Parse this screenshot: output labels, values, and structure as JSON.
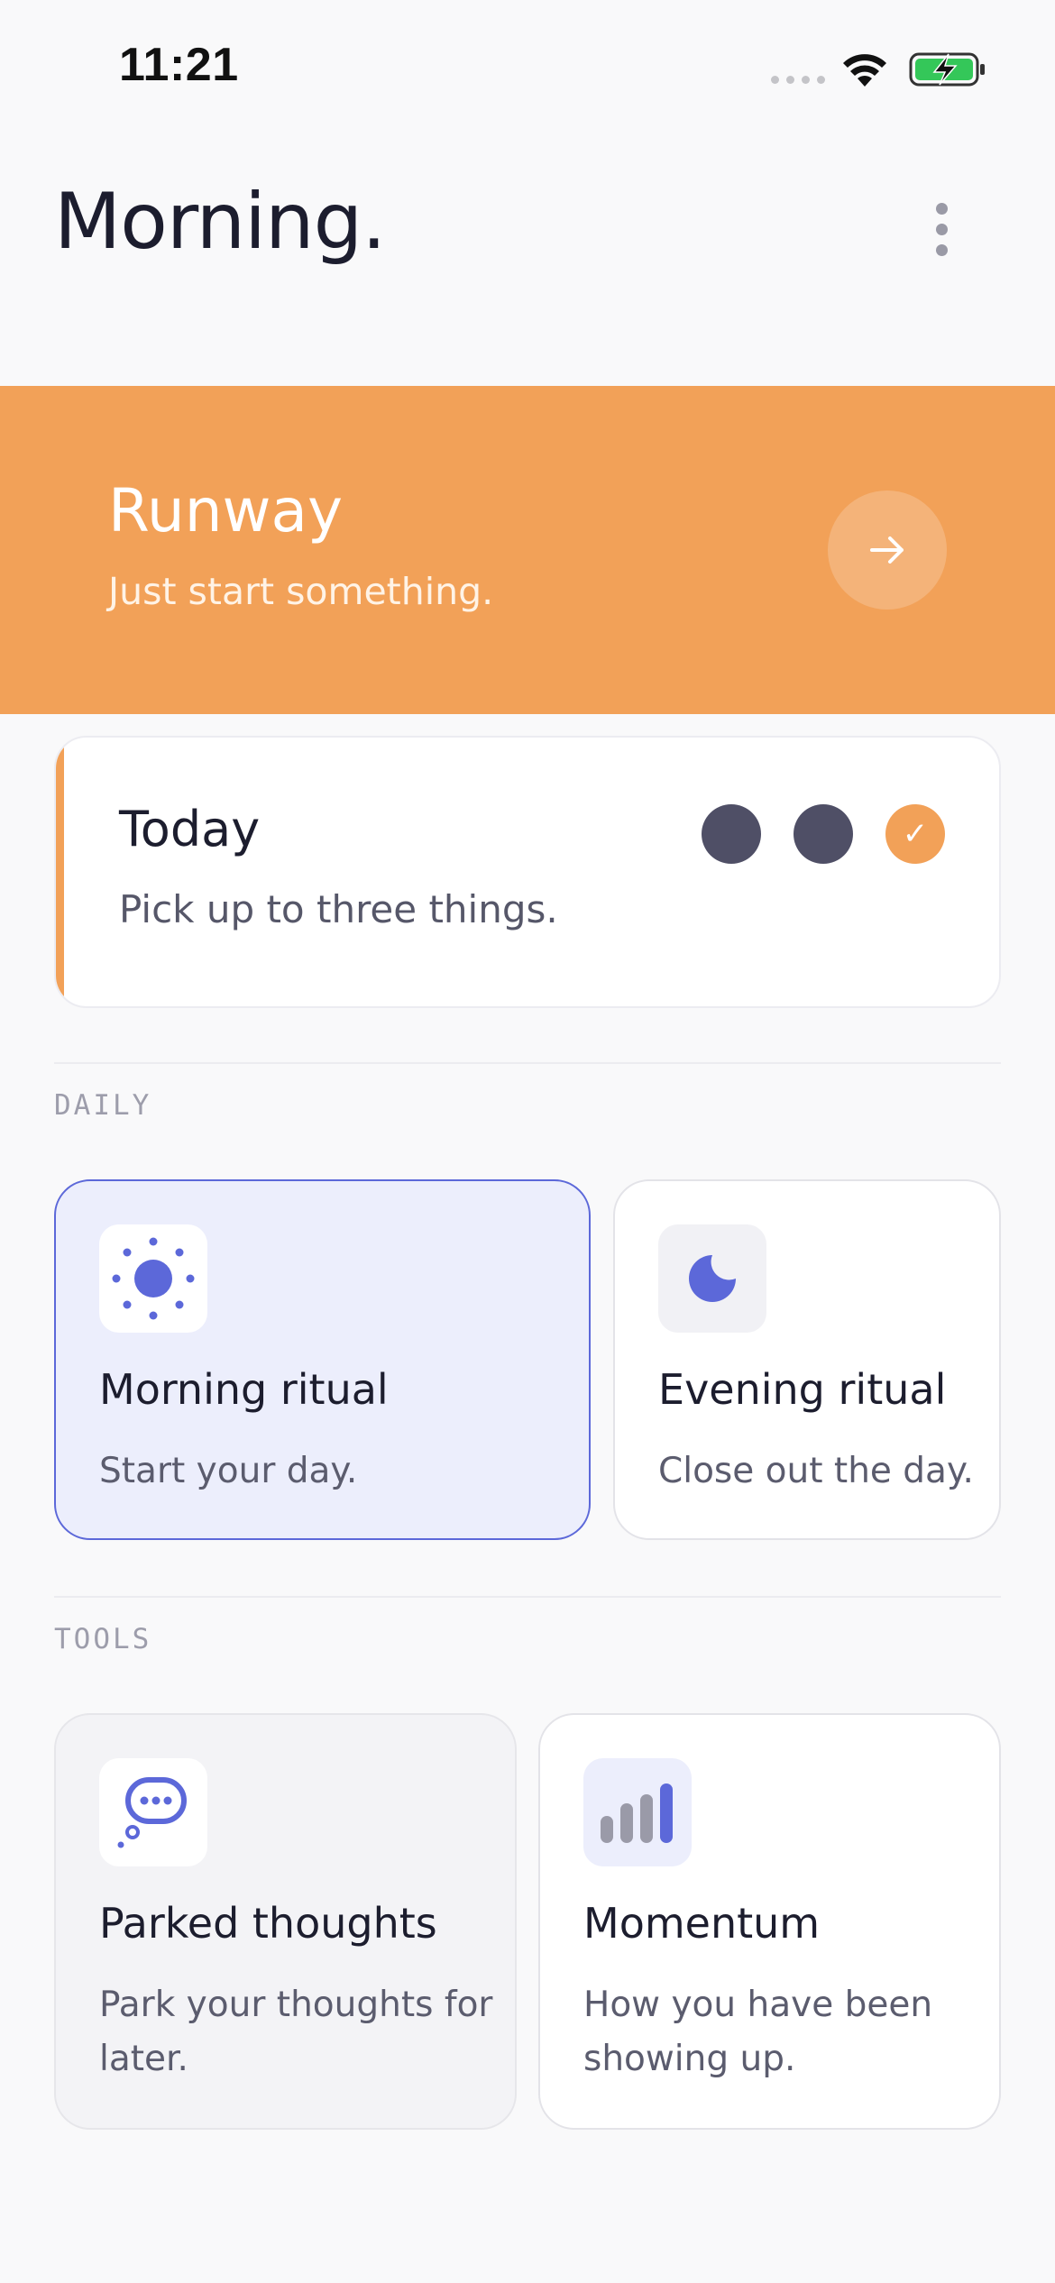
{
  "status_bar": {
    "time": "11:21"
  },
  "header": {
    "title": "Morning."
  },
  "runway": {
    "title": "Runway",
    "subtitle": "Just start something."
  },
  "today": {
    "title": "Today",
    "subtitle": "Pick up to three things.",
    "slots": [
      {
        "state": "empty"
      },
      {
        "state": "empty"
      },
      {
        "state": "done",
        "mark": "✓"
      }
    ]
  },
  "daily": {
    "label": "DAILY",
    "cards": [
      {
        "title": "Morning ritual",
        "description": "Start your day.",
        "icon": "sun-icon",
        "selected": true
      },
      {
        "title": "Evening ritual",
        "description": "Close out the day.",
        "icon": "moon-icon",
        "selected": false
      }
    ]
  },
  "tools": {
    "label": "TOOLS",
    "cards": [
      {
        "title": "Parked thoughts",
        "description": "Park your thoughts for later.",
        "icon": "thought-bubble-icon"
      },
      {
        "title": "Momentum",
        "description": "How you have been showing up.",
        "icon": "bar-chart-icon"
      }
    ]
  },
  "colors": {
    "accent_orange": "#f2a158",
    "accent_blue": "#5c68d9",
    "dot_dark": "#4f4f66",
    "background": "#f9f9fa"
  }
}
